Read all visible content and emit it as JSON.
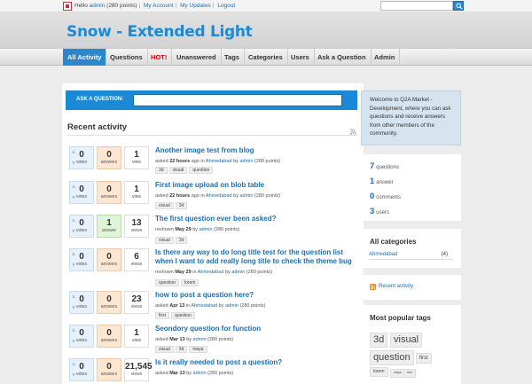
{
  "topbar": {
    "greeting_prefix": "Hello",
    "user": "admin",
    "points": "(280 points)",
    "links": [
      "My Account",
      "My Updates",
      "Logout"
    ]
  },
  "site": {
    "title": "Snow - Extended Light"
  },
  "nav": {
    "items": [
      "All Activity",
      "Questions",
      "HOT!",
      "Unanswered",
      "Tags",
      "Categories",
      "Users",
      "Ask a Question",
      "Admin"
    ],
    "active": "All Activity"
  },
  "ask": {
    "label": "ASK A QUESTION:"
  },
  "activity": {
    "title": "Recent activity",
    "questions": [
      {
        "title": "Another image test from blog",
        "votes": "0",
        "votes_label": "votes",
        "answers": "0",
        "answers_label": "answers",
        "views": "1",
        "views_label": "view",
        "meta": {
          "action": "asked",
          "when": "22 hours",
          "in_word": "ago in",
          "category": "Ahmedabad",
          "by": "by",
          "user": "admin",
          "points": "(280 points)"
        },
        "tags": [
          "3d",
          "visual",
          "question"
        ]
      },
      {
        "title": "First image upload on blob table",
        "votes": "0",
        "votes_label": "votes",
        "answers": "0",
        "answers_label": "answers",
        "views": "1",
        "views_label": "view",
        "meta": {
          "action": "asked",
          "when": "22 hours",
          "in_word": "ago in",
          "category": "Ahmedabad",
          "by": "by",
          "user": "admin",
          "points": "(280 points)"
        },
        "tags": [
          "visual",
          "3d"
        ]
      },
      {
        "title": "The first question ever been asked?",
        "votes": "0",
        "votes_label": "votes",
        "answers": "1",
        "answers_label": "answer",
        "views": "13",
        "views_label": "views",
        "meta": {
          "action": "reshown",
          "when": "May 29",
          "in_word": "",
          "category": "",
          "by": "by",
          "user": "admin",
          "points": "(280 points)"
        },
        "tags": [
          "visual",
          "3d"
        ]
      },
      {
        "title": "Is there any way to do long title test for the question list when I want to add really long title to check the theme bug",
        "votes": "0",
        "votes_label": "votes",
        "answers": "0",
        "answers_label": "answers",
        "views": "6",
        "views_label": "views",
        "meta": {
          "action": "reshown",
          "when": "May 29",
          "in_word": "in",
          "category": "Ahmedabad",
          "by": "by",
          "user": "admin",
          "points": "(280 points)"
        },
        "tags": [
          "question",
          "lorem"
        ]
      },
      {
        "title": "how to post a question here?",
        "votes": "0",
        "votes_label": "votes",
        "answers": "0",
        "answers_label": "answers",
        "views": "23",
        "views_label": "views",
        "meta": {
          "action": "asked",
          "when": "Apr 13",
          "in_word": "in",
          "category": "Ahmedabad",
          "by": "by",
          "user": "admin",
          "points": "(280 points)"
        },
        "tags": [
          "first",
          "question"
        ]
      },
      {
        "title": "Seondory question for function",
        "votes": "0",
        "votes_label": "votes",
        "answers": "0",
        "answers_label": "answers",
        "views": "1",
        "views_label": "view",
        "meta": {
          "action": "asked",
          "when": "Mar 13",
          "in_word": "",
          "category": "",
          "by": "by",
          "user": "admin",
          "points": "(280 points)"
        },
        "tags": [
          "visual",
          "3d",
          "maya"
        ]
      },
      {
        "title": "Is it really needed to post a question?",
        "votes": "0",
        "votes_label": "votes",
        "answers": "0",
        "answers_label": "answers",
        "views": "21,545",
        "views_label": "views",
        "meta": {
          "action": "asked",
          "when": "Mar 13",
          "in_word": "",
          "category": "",
          "by": "by",
          "user": "admin",
          "points": "(280 points)"
        },
        "tags": []
      }
    ]
  },
  "sidebar": {
    "welcome": "Welcome to Q2A Market - Development, where you can ask questions and receive answers from other members of the community.",
    "stats": [
      {
        "num": "7",
        "label": "questions"
      },
      {
        "num": "1",
        "label": "answer"
      },
      {
        "num": "0",
        "label": "comments"
      },
      {
        "num": "3",
        "label": "users"
      }
    ],
    "categories": {
      "title": "All categories",
      "items": [
        {
          "name": "Ahmedabad",
          "count": "(4)"
        }
      ]
    },
    "feed": {
      "label": "Recent activity"
    },
    "tags": {
      "title": "Most popular tags",
      "cloud": [
        "3d",
        "visual",
        "question",
        "first",
        "lorem",
        "maya",
        "test"
      ]
    }
  },
  "colors": {
    "accent": "#1a8ad6",
    "hot": "#dd0000",
    "link": "#1a6fb5"
  }
}
